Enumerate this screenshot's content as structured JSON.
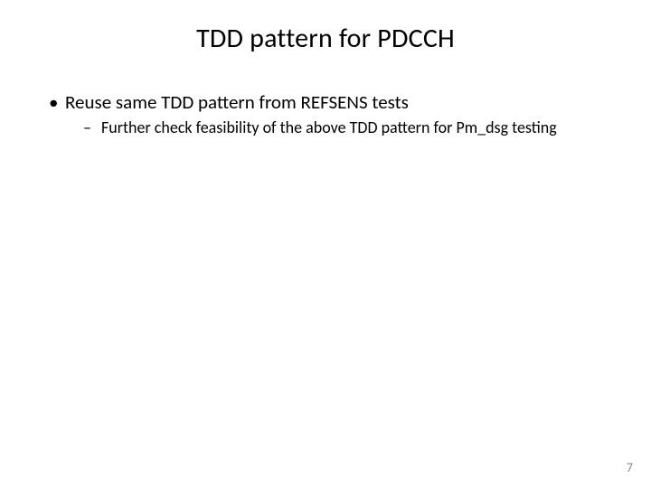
{
  "slide": {
    "title": "TDD pattern for PDCCH",
    "bullets": {
      "level1": {
        "item0": {
          "text": "Reuse same TDD pattern from REFSENS tests",
          "sub": {
            "item0": "Further check feasibility of the above TDD pattern for Pm_dsg testing"
          }
        }
      }
    },
    "page_number": "7"
  }
}
